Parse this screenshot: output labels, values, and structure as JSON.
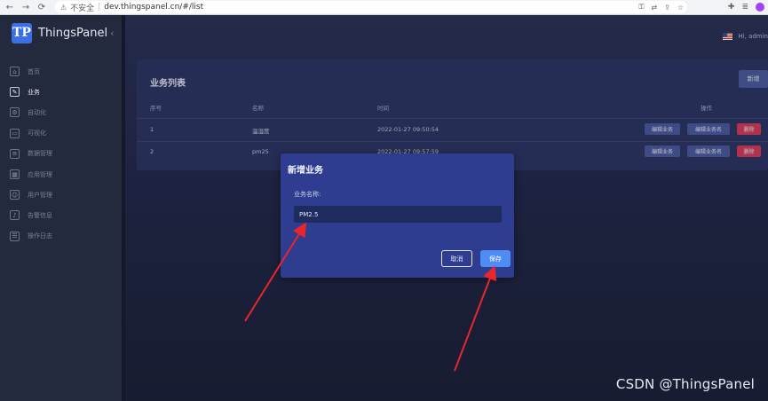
{
  "browser": {
    "back": "←",
    "forward": "→",
    "reload": "⟳",
    "warning_icon": "⚠",
    "insecure_label": "不安全",
    "separator": "|",
    "url": "dev.thingspanel.cn/#/list",
    "toolbar_icons": [
      "key-icon",
      "translate-icon",
      "share-icon",
      "star-icon",
      "extension-icon",
      "reading-list-icon"
    ]
  },
  "sidebar": {
    "brand_logo": "TP",
    "brand_name": "ThingsPanel",
    "collapse": "‹",
    "items": [
      {
        "label": "首页",
        "icon": "home-icon",
        "glyph": "⌂",
        "active": false
      },
      {
        "label": "业务",
        "icon": "business-icon",
        "glyph": "✎",
        "active": true
      },
      {
        "label": "自动化",
        "icon": "automation-icon",
        "glyph": "⚙",
        "active": false
      },
      {
        "label": "可视化",
        "icon": "visualization-icon",
        "glyph": "▭",
        "active": false
      },
      {
        "label": "数据管理",
        "icon": "data-icon",
        "glyph": "≡",
        "active": false
      },
      {
        "label": "应用管理",
        "icon": "apps-icon",
        "glyph": "▦",
        "active": false
      },
      {
        "label": "用户管理",
        "icon": "user-icon",
        "glyph": "☺",
        "active": false
      },
      {
        "label": "告警信息",
        "icon": "alarm-icon",
        "glyph": "♪",
        "active": false
      },
      {
        "label": "操作日志",
        "icon": "log-icon",
        "glyph": "☰",
        "active": false
      }
    ]
  },
  "header": {
    "user_greeting": "Hi, admin"
  },
  "list": {
    "title": "业务列表",
    "add_button": "新增",
    "columns": [
      "序号",
      "名称",
      "时间",
      "操作"
    ],
    "rows": [
      {
        "index": "1",
        "name": "温湿度",
        "time": "2022-01-27 09:50:54"
      },
      {
        "index": "2",
        "name": "pm25",
        "time": "2022-01-27 09:57:59"
      }
    ],
    "actions": {
      "edit": "编辑业务",
      "edit_name": "编辑业务名",
      "delete": "删除"
    }
  },
  "modal": {
    "title": "新增业务",
    "field_label": "业务名称:",
    "field_value": "PM2.5",
    "cancel": "取消",
    "save": "保存"
  },
  "annotations": {
    "arrow_color": "#e8262b"
  },
  "watermark": "CSDN @ThingsPanel"
}
